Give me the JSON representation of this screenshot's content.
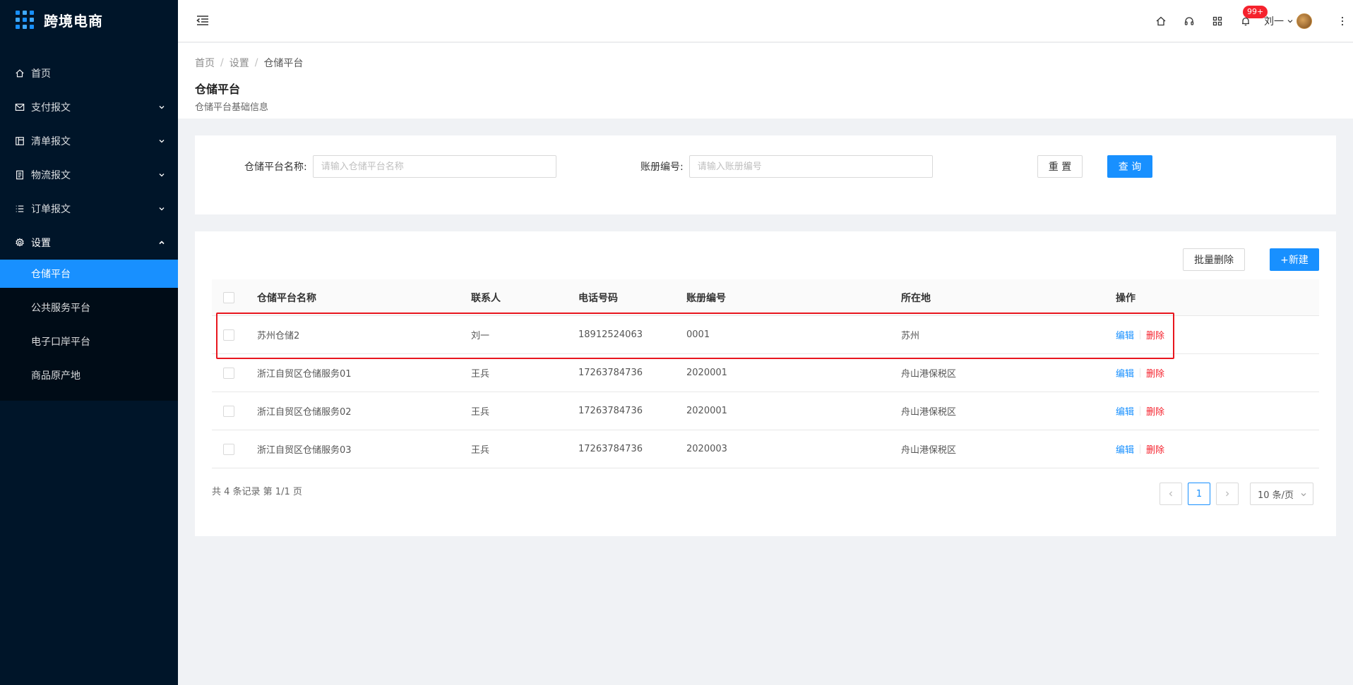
{
  "app": {
    "title": "跨境电商"
  },
  "sidebar": {
    "items": [
      {
        "label": "首页",
        "icon": "home-icon"
      },
      {
        "label": "支付报文",
        "icon": "mail-icon"
      },
      {
        "label": "清单报文",
        "icon": "layout-icon"
      },
      {
        "label": "物流报文",
        "icon": "file-icon"
      },
      {
        "label": "订单报文",
        "icon": "list-icon"
      },
      {
        "label": "设置",
        "icon": "gear-icon"
      }
    ],
    "submenu": [
      {
        "label": "仓储平台",
        "active": true
      },
      {
        "label": "公共服务平台"
      },
      {
        "label": "电子口岸平台"
      },
      {
        "label": "商品原产地"
      }
    ]
  },
  "header": {
    "badge": "99+",
    "user_name": "刘一"
  },
  "breadcrumb": [
    "首页",
    "设置",
    "仓储平台"
  ],
  "page": {
    "title": "仓储平台",
    "subtitle": "仓储平台基础信息"
  },
  "search": {
    "name_label": "仓储平台名称:",
    "name_placeholder": "请输入仓储平台名称",
    "ledger_label": "账册编号:",
    "ledger_placeholder": "请输入账册编号",
    "reset_label": "重 置",
    "query_label": "查 询"
  },
  "toolbar": {
    "batch_delete_label": "批量删除",
    "new_label": "+新建"
  },
  "table": {
    "columns": [
      "仓储平台名称",
      "联系人",
      "电话号码",
      "账册编号",
      "所在地",
      "操作"
    ],
    "rows": [
      {
        "name": "苏州仓储2",
        "contact": "刘一",
        "phone": "18912524063",
        "ledger": "0001",
        "location": "苏州"
      },
      {
        "name": "浙江自贸区仓储服务01",
        "contact": "王兵",
        "phone": "17263784736",
        "ledger": "2020001",
        "location": "舟山港保税区"
      },
      {
        "name": "浙江自贸区仓储服务02",
        "contact": "王兵",
        "phone": "17263784736",
        "ledger": "2020001",
        "location": "舟山港保税区"
      },
      {
        "name": "浙江自贸区仓储服务03",
        "contact": "王兵",
        "phone": "17263784736",
        "ledger": "2020003",
        "location": "舟山港保税区"
      }
    ],
    "edit_label": "编辑",
    "delete_label": "删除"
  },
  "pagination": {
    "summary": "共 4 条记录 第 1/1 页",
    "current": "1",
    "page_size": "10 条/页"
  },
  "colors": {
    "sidebar_bg": "#001529",
    "primary": "#1890ff",
    "danger": "#f5222d",
    "highlight_border": "#e8161e"
  }
}
